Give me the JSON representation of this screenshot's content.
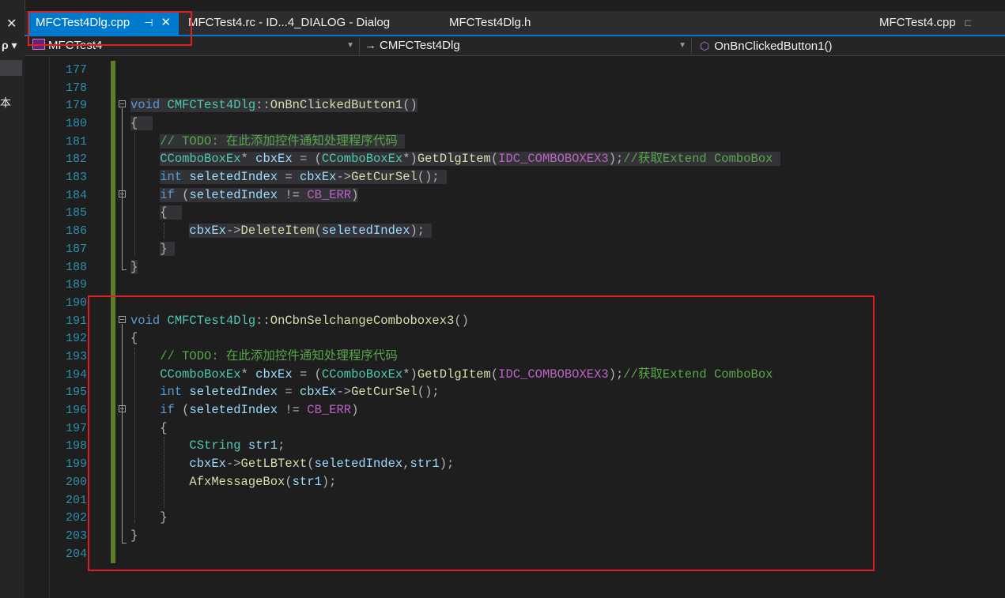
{
  "left_strip": {
    "close_glyph": "✕",
    "search_glyph": "ρ ▾",
    "label": "本"
  },
  "tabs": [
    {
      "label": "MFCTest4Dlg.cpp",
      "pin": "⊣",
      "close": "✕"
    },
    {
      "label": "MFCTest4.rc - ID...4_DIALOG - Dialog"
    },
    {
      "label": "MFCTest4Dlg.h"
    },
    {
      "label": "MFCTest4.cpp",
      "pin": "⊏"
    }
  ],
  "nav": {
    "project": "MFCTest4",
    "class_glyph": "→",
    "class": "CMFCTest4Dlg",
    "method_glyph": "⬡",
    "method": "OnBnClickedButton1()"
  },
  "colors": {
    "accent": "#007acc",
    "highlight_box": "#e02020",
    "change_bar": "#5c7d2a",
    "line_number": "#2b91af"
  },
  "line_numbers": [
    "177",
    "178",
    "179",
    "180",
    "181",
    "182",
    "183",
    "184",
    "185",
    "186",
    "187",
    "188",
    "189",
    "190",
    "191",
    "192",
    "193",
    "194",
    "195",
    "196",
    "197",
    "198",
    "199",
    "200",
    "201",
    "202",
    "203",
    "204"
  ],
  "code": {
    "f1": {
      "sig_void": "void",
      "sig_class": "CMFCTest4Dlg",
      "sig_sep": "::",
      "sig_name": "OnBnClickedButton1",
      "sig_paren": "()",
      "open": "{",
      "comment": "// TODO: 在此添加控件通知处理程序代码",
      "decl_type": "CComboBoxEx",
      "decl_star": "* ",
      "decl_var": "cbxEx",
      "decl_eq": " = (",
      "decl_cast": "CComboBoxEx",
      "decl_cast_star": "*)",
      "decl_fn": "GetDlgItem",
      "decl_open": "(",
      "decl_macro": "IDC_COMBOBOXEX3",
      "decl_close": ");",
      "decl_comment": "//获取Extend ComboBox",
      "int_kw": "int",
      "int_var": " seletedIndex",
      "int_eq": " = ",
      "int_obj": "cbxEx",
      "int_arrow": "->",
      "int_fn": "GetCurSel",
      "int_end": "();",
      "if_kw": "if",
      "if_open": " (",
      "if_var": "seletedIndex",
      "if_op": " != ",
      "if_macro": "CB_ERR",
      "if_close": ")",
      "inner_open": "{",
      "del_obj": "cbxEx",
      "del_arrow": "->",
      "del_fn": "DeleteItem",
      "del_open": "(",
      "del_arg": "seletedIndex",
      "del_close": ");",
      "inner_close": "}",
      "close": "}"
    },
    "f2": {
      "sig_void": "void",
      "sig_class": "CMFCTest4Dlg",
      "sig_sep": "::",
      "sig_name": "OnCbnSelchangeComboboxex3",
      "sig_paren": "()",
      "open": "{",
      "comment": "// TODO: 在此添加控件通知处理程序代码",
      "decl_type": "CComboBoxEx",
      "decl_star": "* ",
      "decl_var": "cbxEx",
      "decl_eq": " = (",
      "decl_cast": "CComboBoxEx",
      "decl_cast_star": "*)",
      "decl_fn": "GetDlgItem",
      "decl_open": "(",
      "decl_macro": "IDC_COMBOBOXEX3",
      "decl_close": ");",
      "decl_comment": "//获取Extend ComboBox",
      "int_kw": "int",
      "int_var": " seletedIndex",
      "int_eq": " = ",
      "int_obj": "cbxEx",
      "int_arrow": "->",
      "int_fn": "GetCurSel",
      "int_end": "();",
      "if_kw": "if",
      "if_open": " (",
      "if_var": "seletedIndex",
      "if_op": " != ",
      "if_macro": "CB_ERR",
      "if_close": ")",
      "inner_open": "{",
      "str_type": "CString",
      "str_var": " str1",
      "str_end": ";",
      "lb_obj": "cbxEx",
      "lb_arrow": "->",
      "lb_fn": "GetLBText",
      "lb_open": "(",
      "lb_arg1": "seletedIndex",
      "lb_comma": ",",
      "lb_arg2": "str1",
      "lb_close": ");",
      "msg_fn": "AfxMessageBox",
      "msg_open": "(",
      "msg_arg": "str1",
      "msg_close": ");",
      "inner_close": "}",
      "close": "}"
    }
  }
}
